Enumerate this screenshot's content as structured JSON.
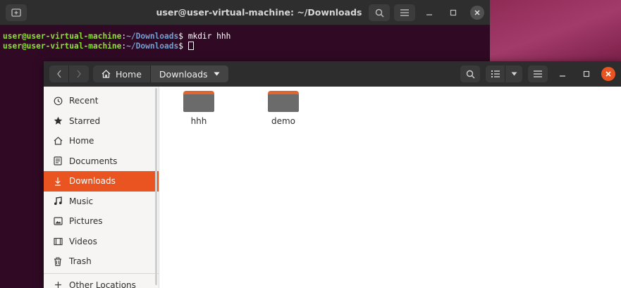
{
  "terminal": {
    "title": "user@user-virtual-machine: ~/Downloads",
    "lines": [
      {
        "user": "user@user-virtual-machine",
        "sep": ":",
        "path": "~/Downloads",
        "prompt": "$ ",
        "command": "mkdir hhh"
      },
      {
        "user": "user@user-virtual-machine",
        "sep": ":",
        "path": "~/Downloads",
        "prompt": "$ ",
        "command": ""
      }
    ]
  },
  "files": {
    "path": {
      "home": "Home",
      "current": "Downloads"
    },
    "sidebar": [
      {
        "label": "Recent",
        "icon": "clock-icon"
      },
      {
        "label": "Starred",
        "icon": "star-icon"
      },
      {
        "label": "Home",
        "icon": "home-icon"
      },
      {
        "label": "Documents",
        "icon": "document-icon"
      },
      {
        "label": "Downloads",
        "icon": "download-icon",
        "active": true
      },
      {
        "label": "Music",
        "icon": "music-icon"
      },
      {
        "label": "Pictures",
        "icon": "picture-icon"
      },
      {
        "label": "Videos",
        "icon": "video-icon"
      },
      {
        "label": "Trash",
        "icon": "trash-icon"
      },
      {
        "label": "Other Locations",
        "icon": "plus-icon"
      }
    ],
    "items": [
      {
        "name": "hhh",
        "type": "folder"
      },
      {
        "name": "demo",
        "type": "folder"
      }
    ]
  },
  "colors": {
    "accent": "#e95420",
    "terminal_bg": "#300a24",
    "prompt_user": "#8ae234",
    "prompt_path": "#729fcf"
  }
}
